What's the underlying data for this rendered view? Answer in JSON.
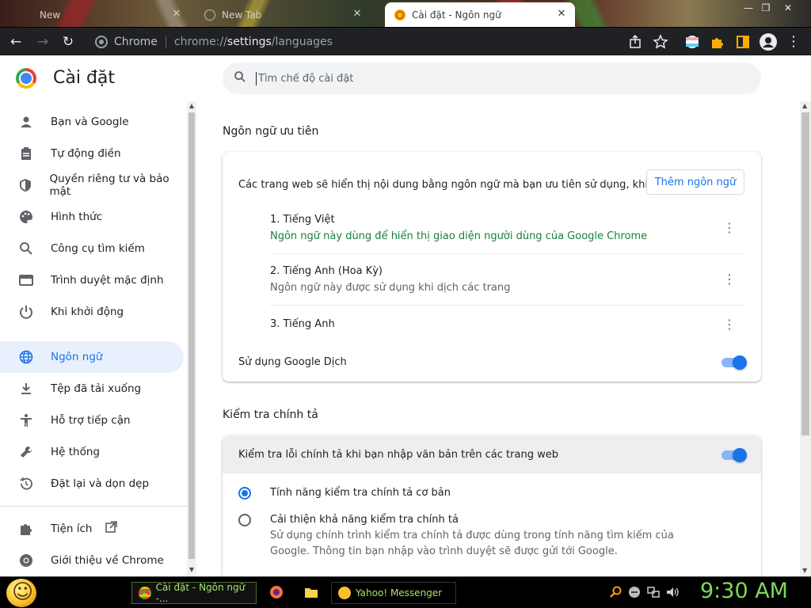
{
  "browser": {
    "tabs": [
      {
        "label": "New",
        "active": false
      },
      {
        "label": "New Tab",
        "active": false
      },
      {
        "label": "Cài đặt - Ngôn ngữ",
        "active": true
      }
    ],
    "omnibox": {
      "site_label": "Chrome",
      "url_prefix": "chrome://",
      "url_strong": "settings",
      "url_suffix": "/languages"
    }
  },
  "settings": {
    "title": "Cài đặt",
    "search_placeholder": "Tìm chế độ cài đặt"
  },
  "sidebar": {
    "items": [
      {
        "label": "Bạn và Google",
        "icon": "person-icon"
      },
      {
        "label": "Tự động điền",
        "icon": "clipboard-icon"
      },
      {
        "label": "Quyền riêng tư và bảo mật",
        "icon": "shield-icon"
      },
      {
        "label": "Hình thức",
        "icon": "palette-icon"
      },
      {
        "label": "Công cụ tìm kiếm",
        "icon": "search-icon"
      },
      {
        "label": "Trình duyệt mặc định",
        "icon": "browser-icon"
      },
      {
        "label": "Khi khởi động",
        "icon": "power-icon"
      },
      {
        "label": "Ngôn ngữ",
        "icon": "globe-icon",
        "active": true
      },
      {
        "label": "Tệp đã tải xuống",
        "icon": "download-icon"
      },
      {
        "label": "Hỗ trợ tiếp cận",
        "icon": "accessibility-icon"
      },
      {
        "label": "Hệ thống",
        "icon": "wrench-icon"
      },
      {
        "label": "Đặt lại và dọn dẹp",
        "icon": "restore-icon"
      },
      {
        "label": "Tiện ích",
        "icon": "puzzle-icon"
      },
      {
        "label": "Giới thiệu về Chrome",
        "icon": "chrome-icon"
      }
    ]
  },
  "languages": {
    "section_title": "Ngôn ngữ ưu tiên",
    "description": "Các trang web sẽ hiển thị nội dung bằng ngôn ngữ mà bạn ưu tiên sử dụng, khi có thể",
    "add_button": "Thêm ngôn ngữ",
    "list": [
      {
        "name": "1. Tiếng Việt",
        "sub": "Ngôn ngữ này dùng để hiển thị giao diện người dùng của Google Chrome"
      },
      {
        "name": "2. Tiếng Anh (Hoa Kỳ)",
        "sub": "Ngôn ngữ này được sử dụng khi dịch các trang"
      },
      {
        "name": "3. Tiếng Anh",
        "sub": ""
      }
    ],
    "translate_label": "Sử dụng Google Dịch",
    "translate_on": true
  },
  "spellcheck": {
    "section_title": "Kiểm tra chính tả",
    "toggle_label": "Kiểm tra lỗi chính tả khi bạn nhập văn bản trên các trang web",
    "toggle_on": true,
    "basic_label": "Tính năng kiểm tra chính tả cơ bản",
    "enhanced_label": "Cải thiện khả năng kiểm tra chính tả",
    "enhanced_sub_1": "Sử dụng chính trình kiểm tra chính tả được dùng trong tính năng tìm kiếm của",
    "enhanced_sub_2": "Google. Thông tin bạn nhập vào trình duyệt sẽ được gửi tới Google.",
    "selected": "basic"
  },
  "taskbar": {
    "chrome_task": "Cài đặt - Ngôn ngữ -...",
    "yahoo_task": "Yahoo! Messenger",
    "clock": "9:30 AM"
  },
  "colors": {
    "accent": "#1a73e8",
    "active_nav_bg": "#e8f0fe",
    "clock": "#7ed957"
  }
}
